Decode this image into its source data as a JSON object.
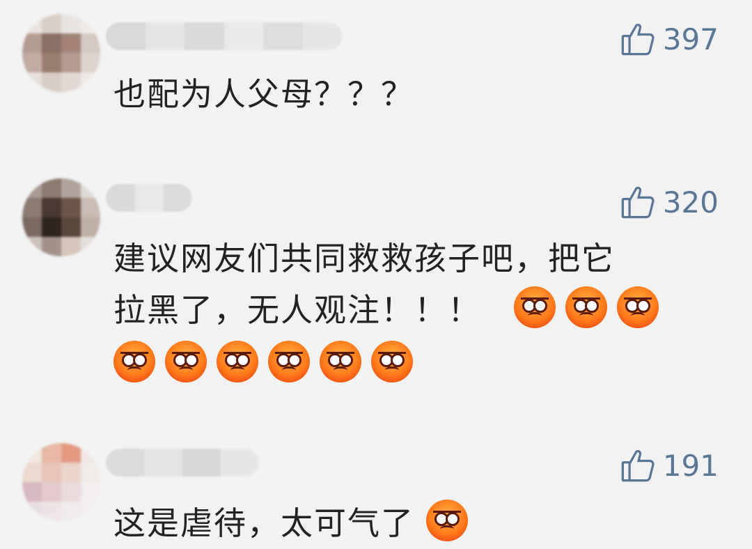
{
  "comments": [
    {
      "likes": "397",
      "text": "也配为人父母？？？",
      "emoji_count": 0,
      "emoji_rows": []
    },
    {
      "likes": "320",
      "text_line1": "建议网友们共同救救孩子吧，把它",
      "text_line2": "拉黑了，无人观注！！！",
      "emoji_inline": 3,
      "emoji_row": 6
    },
    {
      "likes": "191",
      "text": "这是虐待，太可气了"
    }
  ],
  "icons": {
    "like": "thumbs-up-icon",
    "emoji": "angry-face-emoji-icon"
  },
  "colors": {
    "background": "#f2f2f2",
    "like_text": "#5a7696",
    "comment_text": "#222222"
  }
}
